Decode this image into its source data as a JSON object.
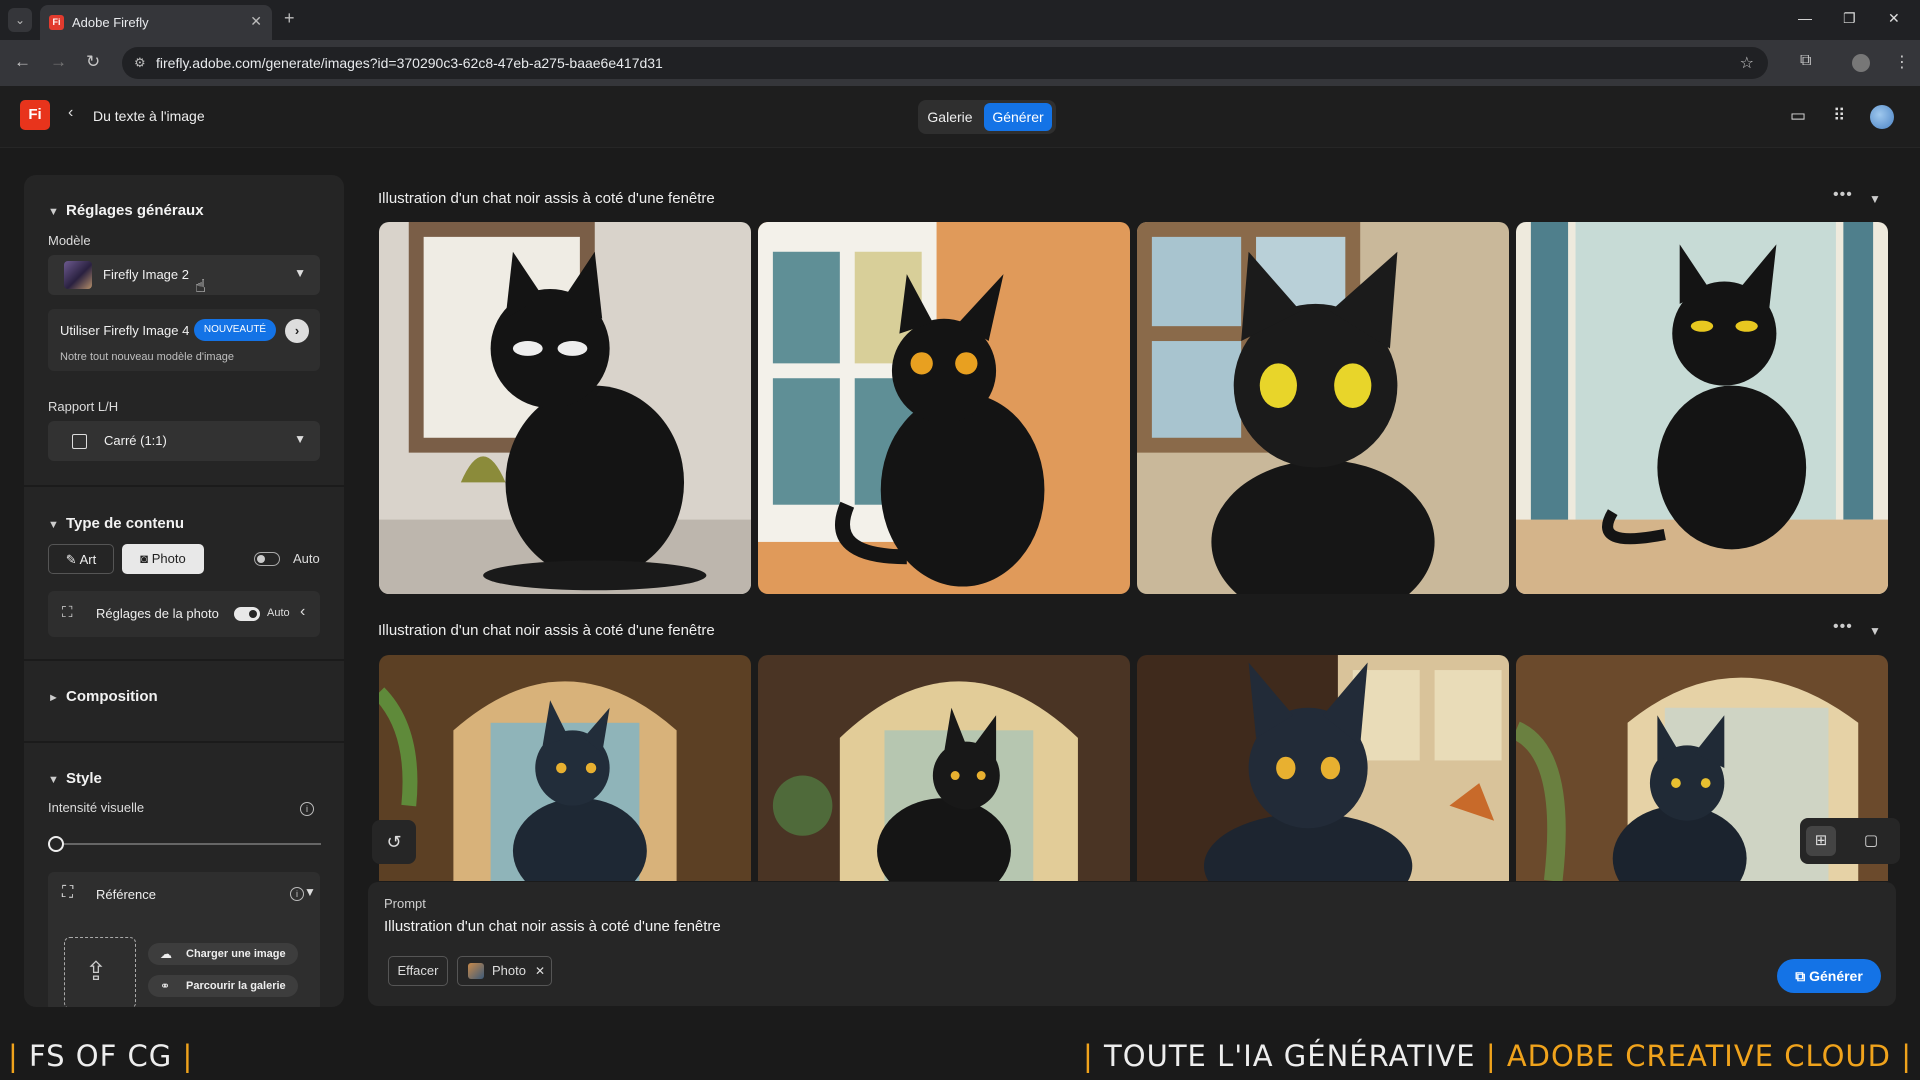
{
  "browser": {
    "tab_title": "Adobe Firefly",
    "url": "firefly.adobe.com/generate/images?id=370290c3-62c8-47eb-a275-baae6e417d31"
  },
  "app": {
    "logo": "Fi",
    "breadcrumb": "Du texte à l'image",
    "tabs": {
      "gallery": "Galerie",
      "generate": "Générer"
    }
  },
  "sidebar": {
    "general_title": "Réglages généraux",
    "model_label": "Modèle",
    "model_value": "Firefly Image 2",
    "promo_title": "Utiliser Firefly Image 4",
    "promo_badge": "NOUVEAUTÉ",
    "promo_sub": "Notre tout nouveau modèle d'image",
    "ratio_label": "Rapport L/H",
    "ratio_value": "Carré (1:1)",
    "content_title": "Type de contenu",
    "content_art": "Art",
    "content_photo": "Photo",
    "content_auto": "Auto",
    "photo_settings": "Réglages de la photo",
    "photo_settings_auto": "Auto",
    "composition_title": "Composition",
    "style_title": "Style",
    "intensity_label": "Intensité visuelle",
    "intensity_value": 0,
    "reference_label": "Référence",
    "upload_label": "Charger une image",
    "browse_label": "Parcourir la galerie"
  },
  "main": {
    "rows": [
      {
        "title": "Illustration d'un chat noir assis à coté d'une fenêtre"
      },
      {
        "title": "Illustration d'un chat noir assis à coté d'une fenêtre"
      }
    ]
  },
  "prompt": {
    "label": "Prompt",
    "text": "Illustration d'un chat noir assis à coté d'une fenêtre",
    "clear": "Effacer",
    "chip": "Photo",
    "generate": "Générer"
  },
  "footer": {
    "left_bar1": "|",
    "left_text": "FS OF CG",
    "left_bar2": "|",
    "right_bar1": "|",
    "right_text1": "TOUTE L'IA GÉNÉRATIVE",
    "right_bar2": "|",
    "right_text2": "ADOBE CREATIVE CLOUD",
    "right_bar3": "|"
  },
  "colors": {
    "accent": "#1473e6",
    "banner_gold": "#f0a31c",
    "logo_red": "#e8341c"
  }
}
